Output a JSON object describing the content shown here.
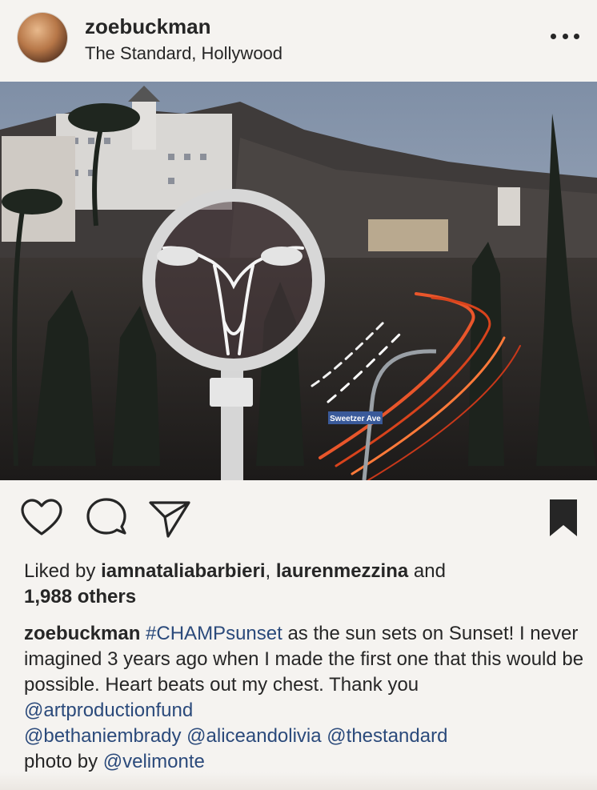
{
  "post": {
    "username": "zoebuckman",
    "location": "The Standard, Hollywood"
  },
  "photo": {
    "street_sign": "Sweetzer Ave"
  },
  "actions": {
    "like_icon": "heart-icon",
    "comment_icon": "comment-icon",
    "share_icon": "send-icon",
    "save_icon": "bookmark-icon"
  },
  "likes": {
    "prefix": "Liked by ",
    "user1": "iamnataliabarbieri",
    "sep": ", ",
    "user2": "laurenmezzina",
    "and": " and",
    "others": "1,988 others"
  },
  "caption": {
    "username": "zoebuckman",
    "hashtag": "#CHAMPsunset",
    "text1": " as the sun sets on Sunset! I never imagined 3 years ago when I made the first one that this would be possible. Heart beats out my chest. Thank you ",
    "mention1": "@artproductionfund",
    "mention2": "@bethaniembrady",
    "mention3": "@aliceandolivia",
    "mention4": "@thestandard",
    "text2": "photo by ",
    "mention5": "@velimonte"
  }
}
